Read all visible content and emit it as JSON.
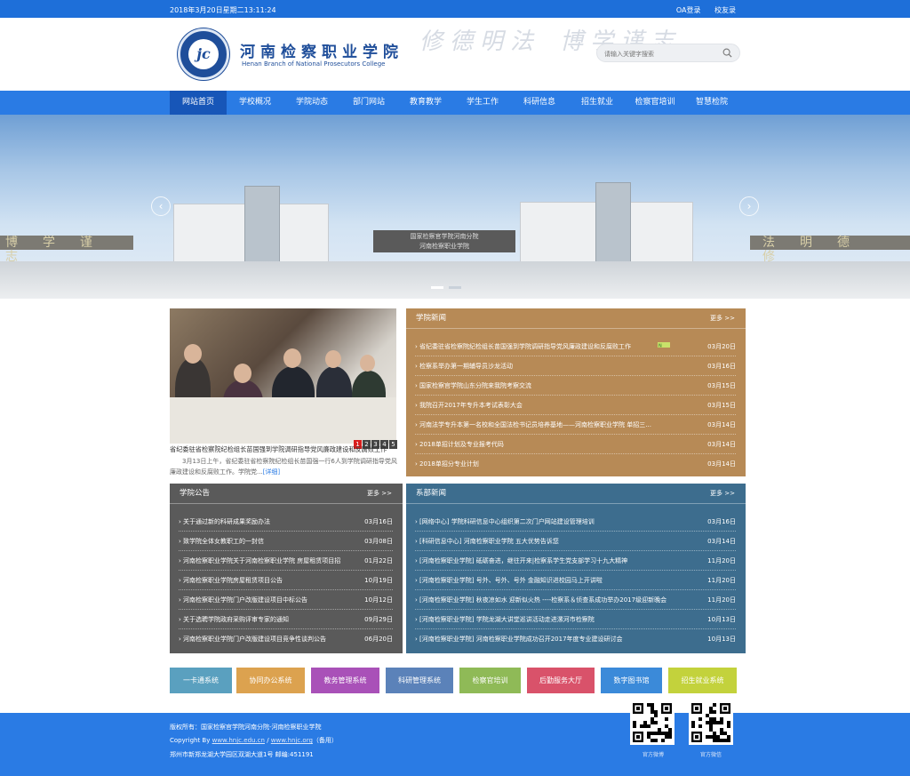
{
  "topbar": {
    "date": "2018年3月20日星期二13:11:24",
    "oa": "OA登录",
    "alumni": "校友录"
  },
  "header": {
    "logo_text": "jc",
    "college_cn": "河南检察职业学院",
    "college_en": "Henan Branch of National Prosecutors College",
    "motto_a": "修德明法",
    "motto_b": "博学谨志",
    "search_placeholder": "请输入关键字搜索"
  },
  "nav": [
    "网站首页",
    "学校概况",
    "学院动态",
    "部门网站",
    "教育教学",
    "学生工作",
    "科研信息",
    "招生就业",
    "检察官培训",
    "智慧检院"
  ],
  "banner": {
    "wall_left": "博学谨志",
    "wall_right": "法明德修",
    "gate_sign_a": "国家检察官学院河南分院",
    "gate_sign_b": "河南检察职业学院"
  },
  "photo_news": {
    "pages": [
      "1",
      "2",
      "3",
      "4",
      "5"
    ],
    "caption": "省纪委驻省检察院纪检组长苗国强到学院调研指导党风廉政建设和反腐败工作",
    "summary": "3月13日上午，省纪委驻省检察院纪检组长苗国强一行6人到学院调研指导党风廉政建设和反腐败工作。学院党...",
    "detail": "[详细]"
  },
  "college_news": {
    "title": "学院新闻",
    "more": "更多 >>",
    "items": [
      {
        "title": "省纪委驻省检察院纪检组长苗国强到学院调研指导党风廉政建设和反腐败工作",
        "date": "03月20日"
      },
      {
        "title": "检察系举办第一期辅导员沙龙活动",
        "date": "03月16日"
      },
      {
        "title": "国家检察官学院山东分院来我院考察交流",
        "date": "03月15日"
      },
      {
        "title": "我院召开2017年专升本考试表彰大会",
        "date": "03月15日"
      },
      {
        "title": "河南法学专升本第一名校和全国法检书记员培养基地——河南检察职业学院 单招三...",
        "date": "03月14日"
      },
      {
        "title": "2018单招计划及专业报考代码",
        "date": "03月14日"
      },
      {
        "title": "2018单招分专业计划",
        "date": "03月14日"
      }
    ]
  },
  "notices": {
    "title": "学院公告",
    "more": "更多 >>",
    "items": [
      {
        "title": "关于通过新的科研成果奖励办法",
        "date": "03月16日"
      },
      {
        "title": "致学院全体女教职工的一封信",
        "date": "03月08日"
      },
      {
        "title": "河南检察职业学院关于河南检察职业学院 房屋租赁项目招",
        "date": "01月22日"
      },
      {
        "title": "河南检察职业学院房屋租赁项目公告",
        "date": "10月19日"
      },
      {
        "title": "河南检察职业学院门户改版建设项目中标公告",
        "date": "10月12日"
      },
      {
        "title": "关于选聘学院政府采购评审专家的通知",
        "date": "09月29日"
      },
      {
        "title": "河南检察职业学院门户改版建设项目竞争性谈判公告",
        "date": "06月20日"
      }
    ]
  },
  "dept_news": {
    "title": "系部新闻",
    "more": "更多 >>",
    "items": [
      {
        "title": "[网络中心] 学院科研信息中心组织第二次门户网站建设管理培训",
        "date": "03月16日"
      },
      {
        "title": "[科研信息中心] 河南检察职业学院 五大优势告诉您",
        "date": "03月14日"
      },
      {
        "title": "[河南检察职业学院] 砥砺奋进，继往开来|检察系学生党支部学习十九大精神",
        "date": "11月20日"
      },
      {
        "title": "[河南检察职业学院] 号外、号外、号外 金融知识进校园马上开讲啦",
        "date": "11月20日"
      },
      {
        "title": "[河南检察职业学院] 秋夜凉如水 迎新似火热 ----检察系＆侦查系成功举办2017级迎新晚会",
        "date": "11月20日"
      },
      {
        "title": "[河南检察职业学院] 学院龙湖大讲堂巡讲活动走进漯河市检察院",
        "date": "10月13日"
      },
      {
        "title": "[河南检察职业学院] 河南检察职业学院成功召开2017年度专业建设研讨会",
        "date": "10月13日"
      }
    ]
  },
  "systems": [
    {
      "label": "一卡通系统",
      "color": "#5aa0bf"
    },
    {
      "label": "协同办公系统",
      "color": "#dca24f"
    },
    {
      "label": "教务管理系统",
      "color": "#a951b8"
    },
    {
      "label": "科研管理系统",
      "color": "#5b82b9"
    },
    {
      "label": "检察官培训",
      "color": "#8fba57"
    },
    {
      "label": "后勤服务大厅",
      "color": "#d9526a"
    },
    {
      "label": "数字图书馆",
      "color": "#3b8ad9"
    },
    {
      "label": "招生就业系统",
      "color": "#c3d23c"
    }
  ],
  "footer": {
    "copyright_owner": "版权所有：国家检察官学院河南分院-河南检察职业学院",
    "copyright_prefix": "Copyright By",
    "site1": "www.hnjc.edu.cn",
    "sep": " / ",
    "site2": "www.hnjc.org",
    "backup": "（备用）",
    "address": "郑州市新郑龙湖大学园区双湖大道1号 邮编:451191",
    "qr1_label": "官方微博",
    "qr2_label": "官方微信"
  },
  "colors": {
    "brand": "#1e6fd9",
    "nav": "#2a7be4",
    "news": "#b78a56",
    "notice": "#5a5a5a",
    "dept": "#3d6d8e"
  }
}
